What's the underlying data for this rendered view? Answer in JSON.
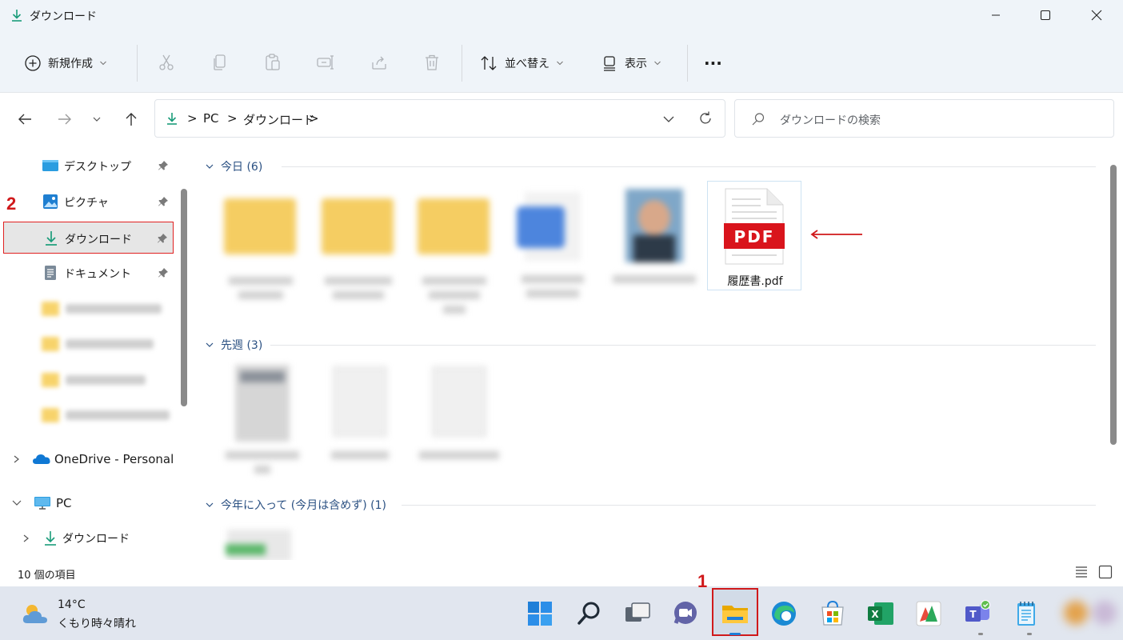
{
  "window": {
    "title": "ダウンロード"
  },
  "toolbar": {
    "new_label": "新規作成",
    "sort_label": "並べ替え",
    "view_label": "表示",
    "more_label": "···"
  },
  "address": {
    "crumbs": [
      "PC",
      "ダウンロード"
    ],
    "separator": ">",
    "search_placeholder": "ダウンロードの検索"
  },
  "sidebar": {
    "quick_access": [
      {
        "label": "デスクトップ",
        "icon": "desktop-icon",
        "pinned": true
      },
      {
        "label": "ピクチャ",
        "icon": "pictures-icon",
        "pinned": true
      },
      {
        "label": "ダウンロード",
        "icon": "download-icon",
        "pinned": true,
        "selected": true
      },
      {
        "label": "ドキュメント",
        "icon": "documents-icon",
        "pinned": true
      }
    ],
    "onedrive_label": "OneDrive - Personal",
    "pc_label": "PC",
    "pc_child_label": "ダウンロード"
  },
  "content": {
    "groups": [
      {
        "header": "今日 (6)"
      },
      {
        "header": "先週 (3)"
      },
      {
        "header": "今年に入って (今月は含めず) (1)"
      }
    ],
    "highlighted_file": {
      "name": "履歴書.pdf",
      "badge": "PDF"
    }
  },
  "status": {
    "item_count": "10 個の項目"
  },
  "taskbar": {
    "weather_temp": "14°C",
    "weather_desc": "くもり時々晴れ"
  },
  "annotations": {
    "step1": "1",
    "step2": "2"
  },
  "colors": {
    "accent": "#0067c0",
    "highlight_red": "#e02020",
    "pdf_red": "#d9141c",
    "folder_yellow": "#f7d36b"
  }
}
